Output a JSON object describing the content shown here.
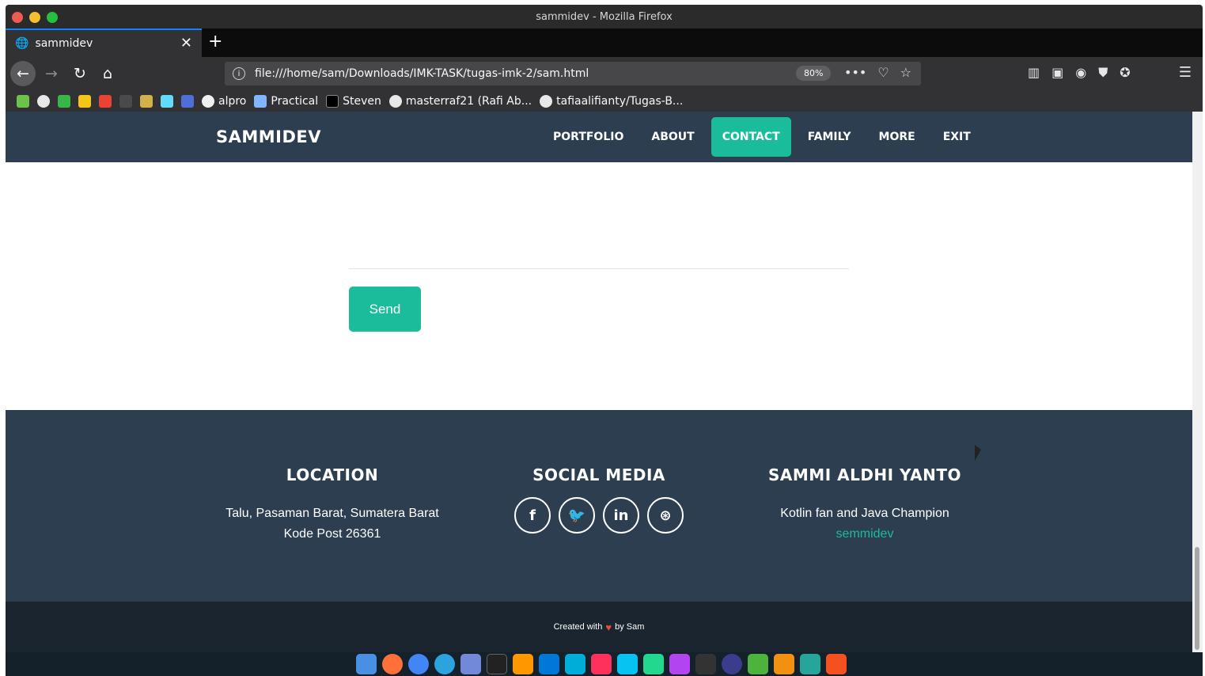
{
  "window": {
    "title": "sammidev - Mozilla Firefox"
  },
  "tabs": [
    {
      "label": "sammidev",
      "active": true
    }
  ],
  "toolbar": {
    "url": "file:///home/sam/Downloads/IMK-TASK/tugas-imk-2/sam.html",
    "zoom": "80%"
  },
  "bookmarks": [
    {
      "label": "alpro",
      "icon": "github-icon"
    },
    {
      "label": "Practical",
      "icon": "feather-icon"
    },
    {
      "label": "Steven",
      "icon": "dev-icon"
    },
    {
      "label": "masterraf21 (Rafi Ab...",
      "icon": "github-icon"
    },
    {
      "label": "tafiaalifianty/Tugas-B...",
      "icon": "github-icon"
    }
  ],
  "site": {
    "brand": "SAMMIDEV",
    "nav": [
      "PORTFOLIO",
      "ABOUT",
      "CONTACT",
      "FAMILY",
      "MORE",
      "EXIT"
    ],
    "active_nav": "CONTACT",
    "send_label": "Send"
  },
  "footer": {
    "location": {
      "title": "LOCATION",
      "line1": "Talu, Pasaman Barat, Sumatera Barat",
      "line2": "Kode Post 26361"
    },
    "social": {
      "title": "SOCIAL MEDIA",
      "icons": [
        "facebook-icon",
        "twitter-icon",
        "linkedin-icon",
        "dribbble-icon"
      ]
    },
    "about": {
      "title": "SAMMI ALDHI YANTO",
      "text": "Kotlin fan and Java Champion",
      "link": "semmidev"
    },
    "copyright_pre": "Created with",
    "copyright_post": "by Sam"
  },
  "colors": {
    "accent": "#1abc9c",
    "primary": "#2c3e50",
    "dark": "#1a252f"
  }
}
